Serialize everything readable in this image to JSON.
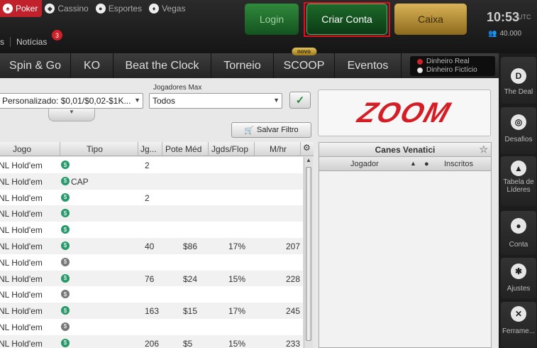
{
  "top": {
    "categories": [
      {
        "label": "Poker",
        "icon": "spade-icon",
        "glyph": "♠",
        "active": true
      },
      {
        "label": "Cassino",
        "icon": "chip-icon",
        "glyph": "◆",
        "active": false
      },
      {
        "label": "Esportes",
        "icon": "ball-icon",
        "glyph": "●",
        "active": false
      },
      {
        "label": "Vegas",
        "icon": "diamond-icon",
        "glyph": "♦",
        "active": false
      }
    ],
    "news_prefix": "s",
    "news_label": "Notícias",
    "news_badge": "3",
    "login_label": "Login",
    "criar_label": "Criar Conta",
    "caixa_label": "Caixa",
    "clock": "10:53",
    "clock_tz": "UTC",
    "players_online": "40.000"
  },
  "game_tabs": [
    {
      "label": "Spin & Go",
      "badge": ""
    },
    {
      "label": "KO",
      "badge": ""
    },
    {
      "label": "Beat the Clock",
      "badge": ""
    },
    {
      "label": "Torneio",
      "badge": ""
    },
    {
      "label": "SCOOP",
      "badge": "novo"
    },
    {
      "label": "Eventos",
      "badge": ""
    }
  ],
  "money": {
    "real": "Dinheiro Real",
    "ficticio": "Dinheiro Fictício"
  },
  "filters": {
    "jogadores_label": "Jogadores Max",
    "stake_value": "Personalizado: $0,01/$0,02-$1K...",
    "jogadores_value": "Todos",
    "save_label": "Salvar Filtro"
  },
  "logo_text": "ZOOM",
  "table": {
    "headers": [
      "Jogo",
      "Tipo",
      "Jg...",
      "Pote Méd",
      "Jgds/Flop",
      "M/hr"
    ],
    "rows": [
      {
        "jogo": "NL Hold'em",
        "icon": "green",
        "tipo": "",
        "jg": "2",
        "pote": "",
        "flop": "",
        "mhr": ""
      },
      {
        "jogo": "NL Hold'em",
        "icon": "green",
        "tipo": "CAP",
        "jg": "",
        "pote": "",
        "flop": "",
        "mhr": ""
      },
      {
        "jogo": "NL Hold'em",
        "icon": "green",
        "tipo": "",
        "jg": "2",
        "pote": "",
        "flop": "",
        "mhr": ""
      },
      {
        "jogo": "NL Hold'em",
        "icon": "green",
        "tipo": "",
        "jg": "",
        "pote": "",
        "flop": "",
        "mhr": ""
      },
      {
        "jogo": "NL Hold'em",
        "icon": "green",
        "tipo": "",
        "jg": "",
        "pote": "",
        "flop": "",
        "mhr": ""
      },
      {
        "jogo": "NL Hold'em",
        "icon": "green",
        "tipo": "",
        "jg": "40",
        "pote": "$86",
        "flop": "17%",
        "mhr": "207"
      },
      {
        "jogo": "NL Hold'em",
        "icon": "grey",
        "tipo": "",
        "jg": "",
        "pote": "",
        "flop": "",
        "mhr": ""
      },
      {
        "jogo": "NL Hold'em",
        "icon": "green",
        "tipo": "",
        "jg": "76",
        "pote": "$24",
        "flop": "15%",
        "mhr": "228"
      },
      {
        "jogo": "NL Hold'em",
        "icon": "grey",
        "tipo": "",
        "jg": "",
        "pote": "",
        "flop": "",
        "mhr": ""
      },
      {
        "jogo": "NL Hold'em",
        "icon": "green",
        "tipo": "",
        "jg": "163",
        "pote": "$15",
        "flop": "17%",
        "mhr": "245"
      },
      {
        "jogo": "NL Hold'em",
        "icon": "grey",
        "tipo": "",
        "jg": "",
        "pote": "",
        "flop": "",
        "mhr": ""
      },
      {
        "jogo": "NL Hold'em",
        "icon": "green",
        "tipo": "",
        "jg": "206",
        "pote": "$5",
        "flop": "15%",
        "mhr": "233"
      }
    ]
  },
  "right_panel": {
    "title": "Canes Venatici",
    "col_jogador": "Jogador",
    "col_inscritos": "Inscritos"
  },
  "sidenav": [
    {
      "label": "The Deal",
      "icon": "deal-icon",
      "glyph": "D"
    },
    {
      "label": "Desafios",
      "icon": "target-icon",
      "glyph": "◎"
    },
    {
      "label": "Tabela de Líderes",
      "icon": "leaderboard-icon",
      "glyph": "▲"
    },
    {
      "label": "Conta",
      "icon": "user-icon",
      "glyph": "●"
    },
    {
      "label": "Ajustes",
      "icon": "gear-icon",
      "glyph": "✱"
    },
    {
      "label": "Ferrame...",
      "icon": "tools-icon",
      "glyph": "✕"
    }
  ]
}
